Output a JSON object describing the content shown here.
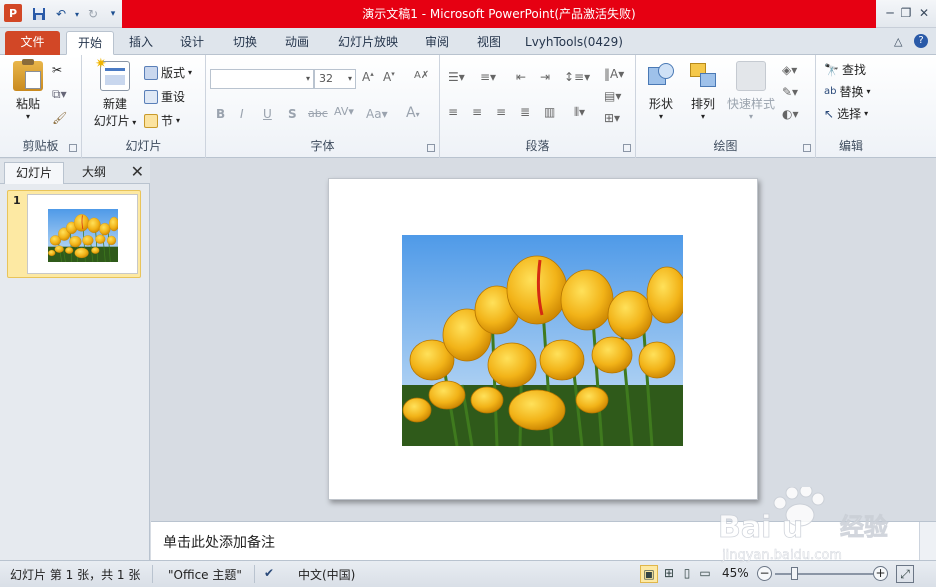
{
  "window": {
    "title": "演示文稿1 - Microsoft PowerPoint(产品激活失败)",
    "app_icon_letter": "P"
  },
  "tabs": [
    {
      "label": "文件",
      "kind": "file"
    },
    {
      "label": "开始",
      "kind": "active"
    },
    {
      "label": "插入",
      "kind": "normal"
    },
    {
      "label": "设计",
      "kind": "normal"
    },
    {
      "label": "切换",
      "kind": "normal"
    },
    {
      "label": "动画",
      "kind": "normal"
    },
    {
      "label": "幻灯片放映",
      "kind": "normal"
    },
    {
      "label": "审阅",
      "kind": "normal"
    },
    {
      "label": "视图",
      "kind": "normal"
    },
    {
      "label": "LvyhTools(0429)",
      "kind": "normal"
    }
  ],
  "ribbon": {
    "clipboard": {
      "label": "剪贴板",
      "paste": "粘贴"
    },
    "slides": {
      "label": "幻灯片",
      "new_slide_line1": "新建",
      "new_slide_line2": "幻灯片",
      "layout": "版式",
      "reset": "重设",
      "section": "节"
    },
    "font": {
      "label": "字体",
      "font_name": "",
      "font_size": "32",
      "bold": "B",
      "italic": "I",
      "underline": "U",
      "shadow": "S",
      "strike": "abc",
      "spacing": "AV",
      "case": "Aa",
      "color": "A"
    },
    "paragraph": {
      "label": "段落"
    },
    "drawing": {
      "label": "绘图",
      "shapes": "形状",
      "arrange": "排列",
      "quick_styles": "快速样式"
    },
    "editing": {
      "label": "编辑",
      "find": "查找",
      "replace": "替换",
      "select": "选择"
    }
  },
  "left_panel": {
    "tab_slides": "幻灯片",
    "tab_outline": "大纲",
    "slide_number": "1"
  },
  "notes": {
    "placeholder": "单击此处添加备注"
  },
  "status": {
    "slide_info": "幻灯片 第 1 张，共 1 张",
    "theme": "\"Office 主题\"",
    "language": "中文(中国)",
    "zoom": "45%",
    "zoom_level": 0.45
  },
  "watermark": {
    "text": "Baidu经验",
    "url": "jingyan.baidu.com"
  }
}
